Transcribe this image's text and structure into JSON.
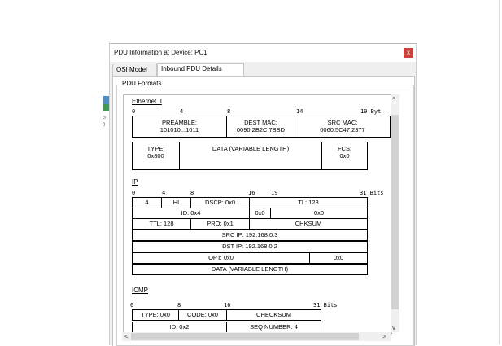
{
  "window": {
    "title": "PDU Information at Device: PC1",
    "close_label": "x"
  },
  "tabs": [
    {
      "label": "OSI Model"
    },
    {
      "label": "Inbound PDU Details"
    }
  ],
  "group_label": "PDU Formats",
  "background": {
    "sliver_text_1": "P",
    "sliver_text_2": "0"
  },
  "ethernet": {
    "title": "Ethernet II",
    "bits": [
      "0",
      "4",
      "8",
      "14",
      "19 Byt"
    ],
    "preamble_label": "PREAMBLE:",
    "preamble_value": "101010...1011",
    "dest_label": "DEST MAC:",
    "dest_value": "0090.2B2C.7BBD",
    "src_label": "SRC MAC:",
    "src_value": "0060.5C47.2377",
    "type_label": "TYPE:",
    "type_value": "0x800",
    "data_label": "DATA (VARIABLE LENGTH)",
    "fcs_label": "FCS:",
    "fcs_value": "0x0"
  },
  "ip": {
    "title": "IP",
    "bits": [
      "0",
      "4",
      "8",
      "16",
      "19",
      "31 Bits"
    ],
    "version": "4",
    "ihl": "IHL",
    "dscp": "DSCP: 0x0",
    "tl": "TL: 128",
    "id": "ID: 0x4",
    "flags": "0x0",
    "frag": "0x0",
    "ttl": "TTL: 128",
    "pro": "PRO: 0x1",
    "chksum": "CHKSUM",
    "src_ip": "SRC IP: 192.168.0.3",
    "dst_ip": "DST IP: 192.168.0.2",
    "opt": "OPT: 0x0",
    "opt_val": "0x0",
    "data": "DATA (VARIABLE LENGTH)"
  },
  "icmp": {
    "title": "ICMP",
    "bits": [
      "0",
      "8",
      "16",
      "31  Bits"
    ],
    "type": "TYPE: 0x0",
    "code": "CODE: 0x0",
    "checksum": "CHECKSUM",
    "id": "ID: 0x2",
    "seq": "SEQ NUMBER: 4"
  },
  "scroll": {
    "up": "^",
    "down": "v",
    "left": "<",
    "right": ">"
  }
}
